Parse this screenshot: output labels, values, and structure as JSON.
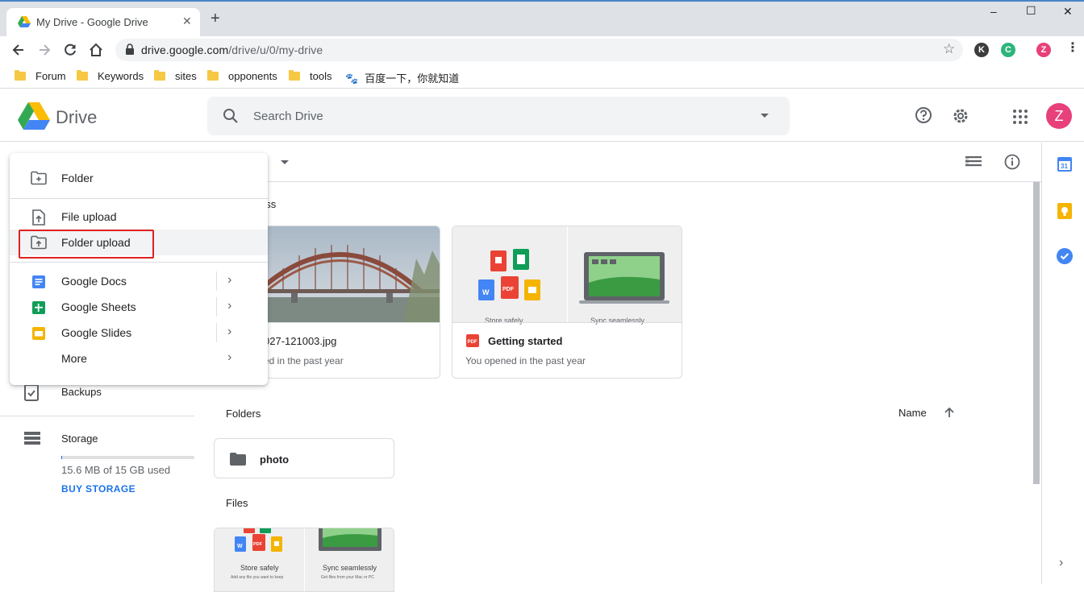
{
  "browser": {
    "tab_title": "My Drive - Google Drive",
    "new_tab": "+",
    "window_controls": [
      "–",
      "☐",
      "✕"
    ],
    "url_host": "drive.google.com",
    "url_path": "/drive/u/0/my-drive",
    "extensions": [
      {
        "letter": "K",
        "color": "#3c3c3c"
      },
      {
        "letter": "C",
        "color": "#2db47d"
      },
      {
        "letter": "Z",
        "color": "#e8407a"
      }
    ],
    "bookmarks": [
      {
        "label": "Forum",
        "type": "folder"
      },
      {
        "label": "Keywords",
        "type": "folder"
      },
      {
        "label": "sites",
        "type": "folder"
      },
      {
        "label": "opponents",
        "type": "folder"
      },
      {
        "label": "tools",
        "type": "folder"
      },
      {
        "label": "百度一下，你就知道",
        "type": "baidu"
      }
    ]
  },
  "header": {
    "app_name": "Drive",
    "search_placeholder": "Search Drive",
    "avatar_letter": "Z",
    "avatar_color": "#e8407a"
  },
  "subheader": {
    "title_fragment": "e"
  },
  "nav": {
    "backups_label": "Backups",
    "storage_label": "Storage",
    "storage_used": "15.6 MB of 15 GB used",
    "storage_fraction": 0.001,
    "buy_storage": "BUY STORAGE"
  },
  "main": {
    "quick_access_fragment": "ess",
    "quick_access": [
      {
        "name": "027-121003.jpg",
        "sub": "ed in the past year"
      },
      {
        "name": "Getting started",
        "sub": "You opened in the past year",
        "thumb_left_caption": "Store safely",
        "thumb_right_caption": "Sync seamlessly"
      }
    ],
    "folders_label": "Folders",
    "sort_label": "Name",
    "folders": [
      {
        "name": "photo"
      }
    ],
    "files_label": "Files",
    "file_thumb": {
      "left_caption": "Store safely",
      "left_sub": "Add any file you want to keep",
      "right_caption": "Sync seamlessly",
      "right_sub": "Get files from your Mac or PC"
    }
  },
  "new_menu": {
    "folder": "Folder",
    "file_upload": "File upload",
    "folder_upload": "Folder upload",
    "google_docs": "Google Docs",
    "google_sheets": "Google Sheets",
    "google_slides": "Google Slides",
    "more": "More"
  },
  "side_panel": {
    "calendar_day": "31"
  },
  "colors": {
    "docs": "#4285f4",
    "sheets": "#0f9d58",
    "slides": "#f4b400",
    "pdf": "#ea4335",
    "accent_blue": "#1a73e8",
    "highlight_red": "#e02020"
  }
}
